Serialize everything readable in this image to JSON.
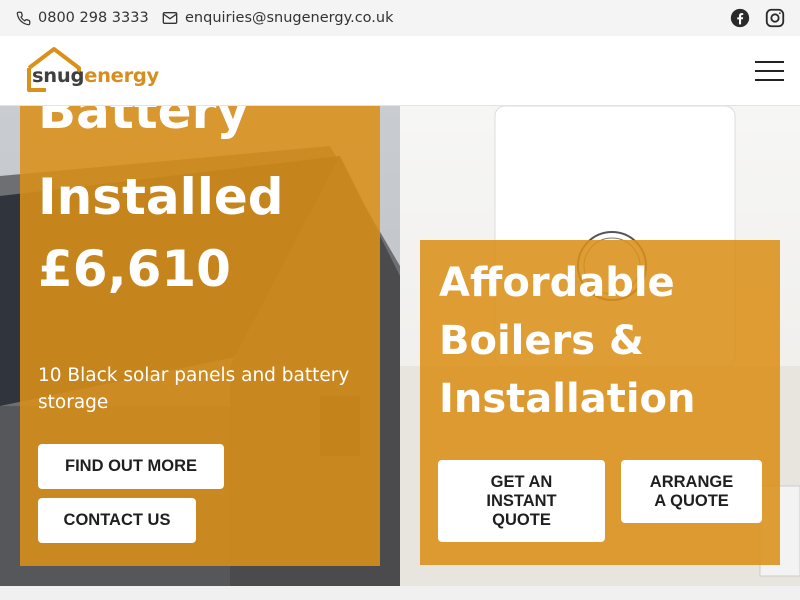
{
  "topbar": {
    "phone": "0800 298 3333",
    "email": "enquiries@snugenergy.co.uk",
    "icons": [
      "phone-icon",
      "envelope-icon",
      "facebook-icon",
      "instagram-icon"
    ]
  },
  "header": {
    "logo_part1": "snug",
    "logo_part2": "energy",
    "menu_icon": "hamburger-menu-icon"
  },
  "hero_left": {
    "line1": "Battery",
    "line2": "Installed",
    "line3": "£6,610",
    "subtitle": "10 Black solar panels and battery storage",
    "button_primary": "FIND OUT MORE",
    "button_secondary": "CONTACT US"
  },
  "hero_right": {
    "line1": "Affordable",
    "line2": "Boilers &",
    "line3": "Installation",
    "button_primary": "GET AN INSTANT QUOTE",
    "button_secondary": "ARRANGE A QUOTE"
  },
  "colors": {
    "accent": "#db9019",
    "logo_grey": "#3f3f3f",
    "white": "#ffffff"
  }
}
